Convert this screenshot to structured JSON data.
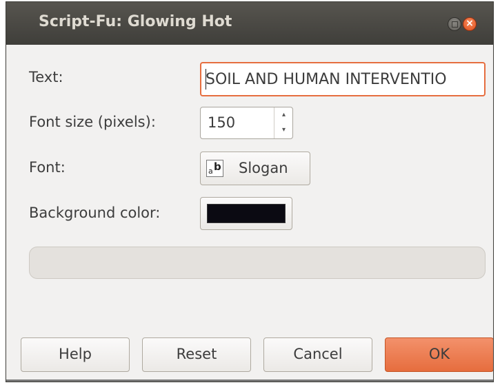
{
  "window": {
    "title": "Script-Fu: Glowing Hot",
    "close_glyph": "×"
  },
  "fields": {
    "text_label": "Text:",
    "text_value": "SOIL AND HUMAN INTERVENTIO",
    "font_size_label": "Font size (pixels):",
    "font_size_value": "150",
    "font_label": "Font:",
    "font_value": "Slogan",
    "font_icon_a": "a",
    "font_icon_b": "b",
    "bg_color_label": "Background color:",
    "bg_color_value": "#0b0a12"
  },
  "progress": {
    "value": 0
  },
  "buttons": {
    "help": "Help",
    "reset": "Reset",
    "cancel": "Cancel",
    "ok": "OK"
  },
  "colors": {
    "accent": "#e66d3e",
    "titlebar": "#3f3e3a",
    "dialog_bg": "#f2f1f0"
  },
  "icons": {
    "spin_up": "▴",
    "spin_down": "▾"
  }
}
